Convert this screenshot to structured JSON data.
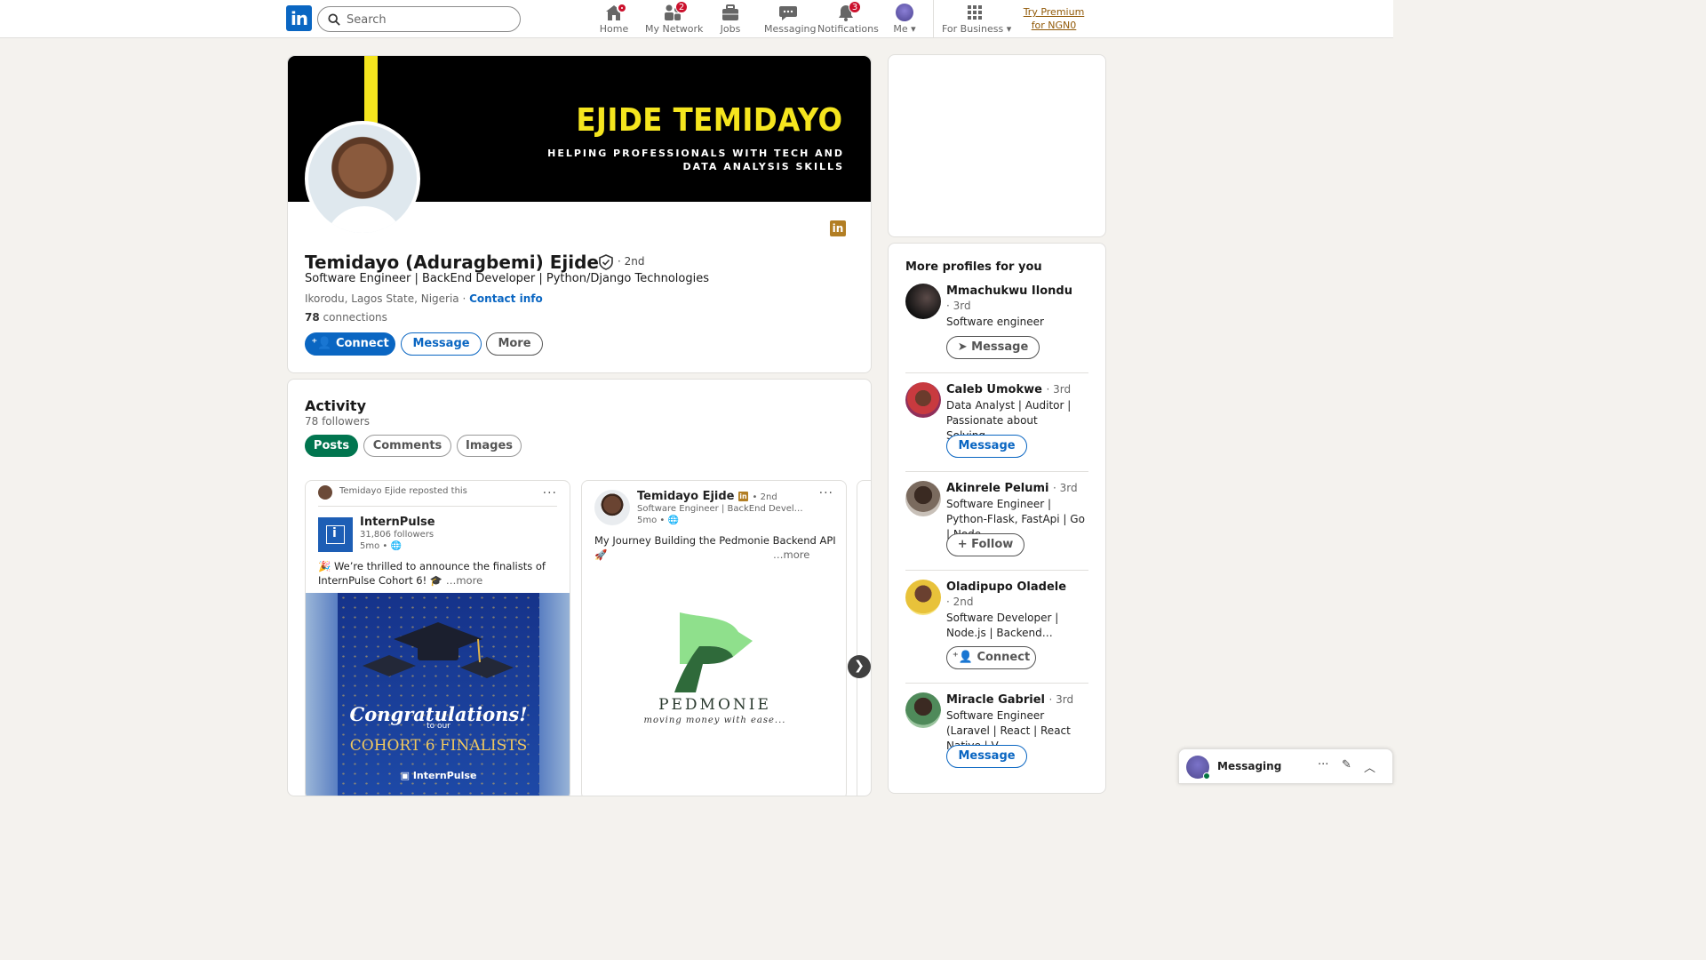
{
  "nav": {
    "logo": "in",
    "search_placeholder": "Search",
    "items": [
      {
        "label": "Home",
        "badge": ""
      },
      {
        "label": "My Network",
        "badge": "2"
      },
      {
        "label": "Jobs",
        "badge": ""
      },
      {
        "label": "Messaging",
        "badge": ""
      },
      {
        "label": "Notifications",
        "badge": "3"
      },
      {
        "label": "Me",
        "badge": ""
      },
      {
        "label": "For Business",
        "badge": ""
      }
    ],
    "premium": "Try Premium for NGN0"
  },
  "profile": {
    "banner_name": "EJIDE TEMIDAYO",
    "banner_tagline": "HELPING PROFESSIONALS WITH TECH AND DATA ANALYSIS SKILLS",
    "name": "Temidayo (Aduragbemi) Ejide",
    "degree": "· 2nd",
    "headline": "Software Engineer | BackEnd Developer | Python/Django Technologies",
    "location": "Ikorodu, Lagos State, Nigeria ·",
    "contact_info": "Contact info",
    "connections_count": "78",
    "connections_label": "connections",
    "buttons": {
      "connect": "Connect",
      "message": "Message",
      "more": "More"
    }
  },
  "activity": {
    "title": "Activity",
    "followers": "78 followers",
    "tabs": [
      "Posts",
      "Comments",
      "Images"
    ],
    "posts": [
      {
        "repost_line": "Temidayo Ejide reposted this",
        "author": "InternPulse",
        "sub": "31,806 followers",
        "time": "5mo •",
        "text": "🎉 We’re thrilled to announce the finalists of InternPulse Cohort 6! 🎓",
        "more": "…more",
        "image": {
          "congrats": "Congratulations!",
          "to_our": "to our",
          "cohort": "COHORT 6 FINALISTS",
          "brand": "InternPulse"
        }
      },
      {
        "author": "Temidayo Ejide",
        "degree": "• 2nd",
        "sub": "Software Engineer | BackEnd Devel…",
        "time": "5mo •",
        "text": "My Journey Building the Pedmonie Backend API 🚀",
        "more": "…more",
        "image": {
          "brand": "PEDMONIE",
          "tagline": "moving money with ease..."
        }
      }
    ]
  },
  "sidebar": {
    "title": "More profiles for you",
    "profiles": [
      {
        "name": "Mmachukwu Ilondu",
        "degree": "· 3rd",
        "headline": "Software engineer",
        "action": "Message"
      },
      {
        "name": "Caleb Umokwe",
        "degree": "· 3rd",
        "headline": "Data Analyst | Auditor | Passionate about Solving…",
        "action": "Message"
      },
      {
        "name": "Akinrele Pelumi",
        "degree": "· 3rd",
        "headline": "Software Engineer | Python-Flask, FastApi | Go | Node…",
        "action": "Follow"
      },
      {
        "name": "Oladipupo Oladele",
        "degree": "· 2nd",
        "headline": "Software Developer | Node.js | Backend…",
        "action": "Connect"
      },
      {
        "name": "Miracle Gabriel",
        "degree": "· 3rd",
        "headline": "Software Engineer (Laravel | React | React Native | V…",
        "action": "Message"
      }
    ]
  },
  "messaging": {
    "label": "Messaging"
  },
  "colors": {
    "linkedin_blue": "#0a66c2",
    "banner_yellow": "#f5e51e",
    "pill_green": "#01754f",
    "badge_red": "#cb112d"
  }
}
